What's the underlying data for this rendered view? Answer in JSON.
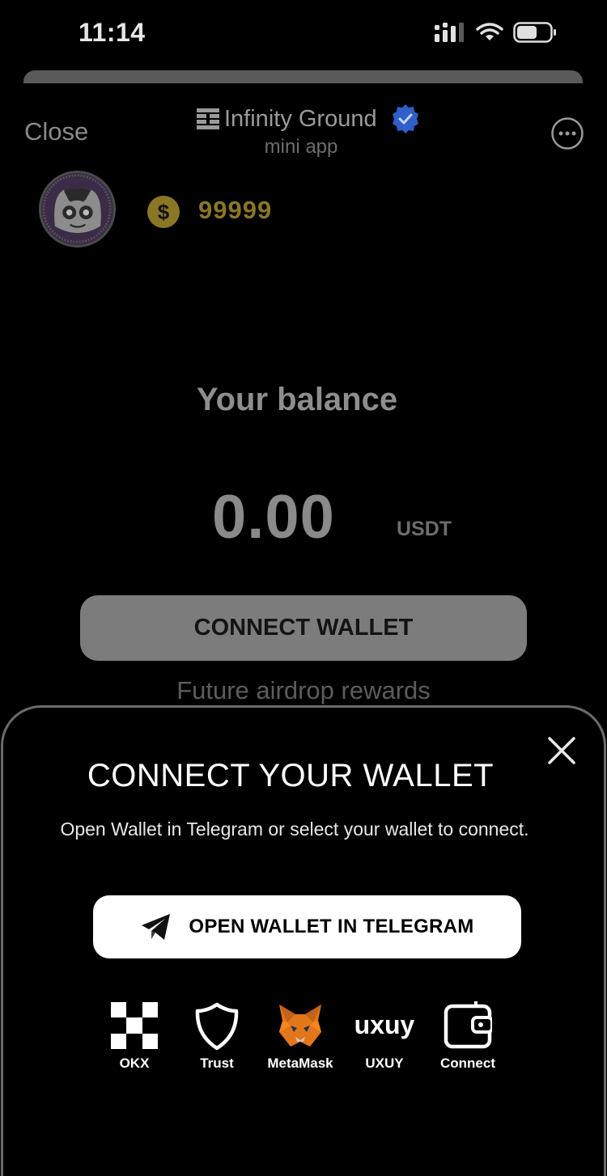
{
  "status_bar": {
    "time": "11:14"
  },
  "header": {
    "close_label": "Close",
    "app_title": "Infinity Ground",
    "app_subtitle": "mini app"
  },
  "profile": {
    "coins": "99999"
  },
  "balance": {
    "label": "Your balance",
    "value": "0.00",
    "unit": "USDT"
  },
  "connect_button_label": "CONNECT WALLET",
  "airdrop_text": "Future airdrop rewards",
  "modal": {
    "title": "CONNECT YOUR WALLET",
    "subtitle": "Open Wallet in Telegram or select your wallet to connect.",
    "telegram_button_label": "OPEN WALLET IN TELEGRAM",
    "wallets": [
      {
        "label": "OKX",
        "icon": "okx-icon"
      },
      {
        "label": "Trust",
        "icon": "trust-shield-icon"
      },
      {
        "label": "MetaMask",
        "icon": "metamask-fox-icon"
      },
      {
        "label": "UXUY",
        "icon": "uxuy-logo-icon"
      },
      {
        "label": "Connect",
        "icon": "wallet-connect-icon"
      }
    ]
  },
  "colors": {
    "background": "#000000",
    "coin_gold": "#8b7626",
    "verified_blue": "#2f5fc8"
  }
}
